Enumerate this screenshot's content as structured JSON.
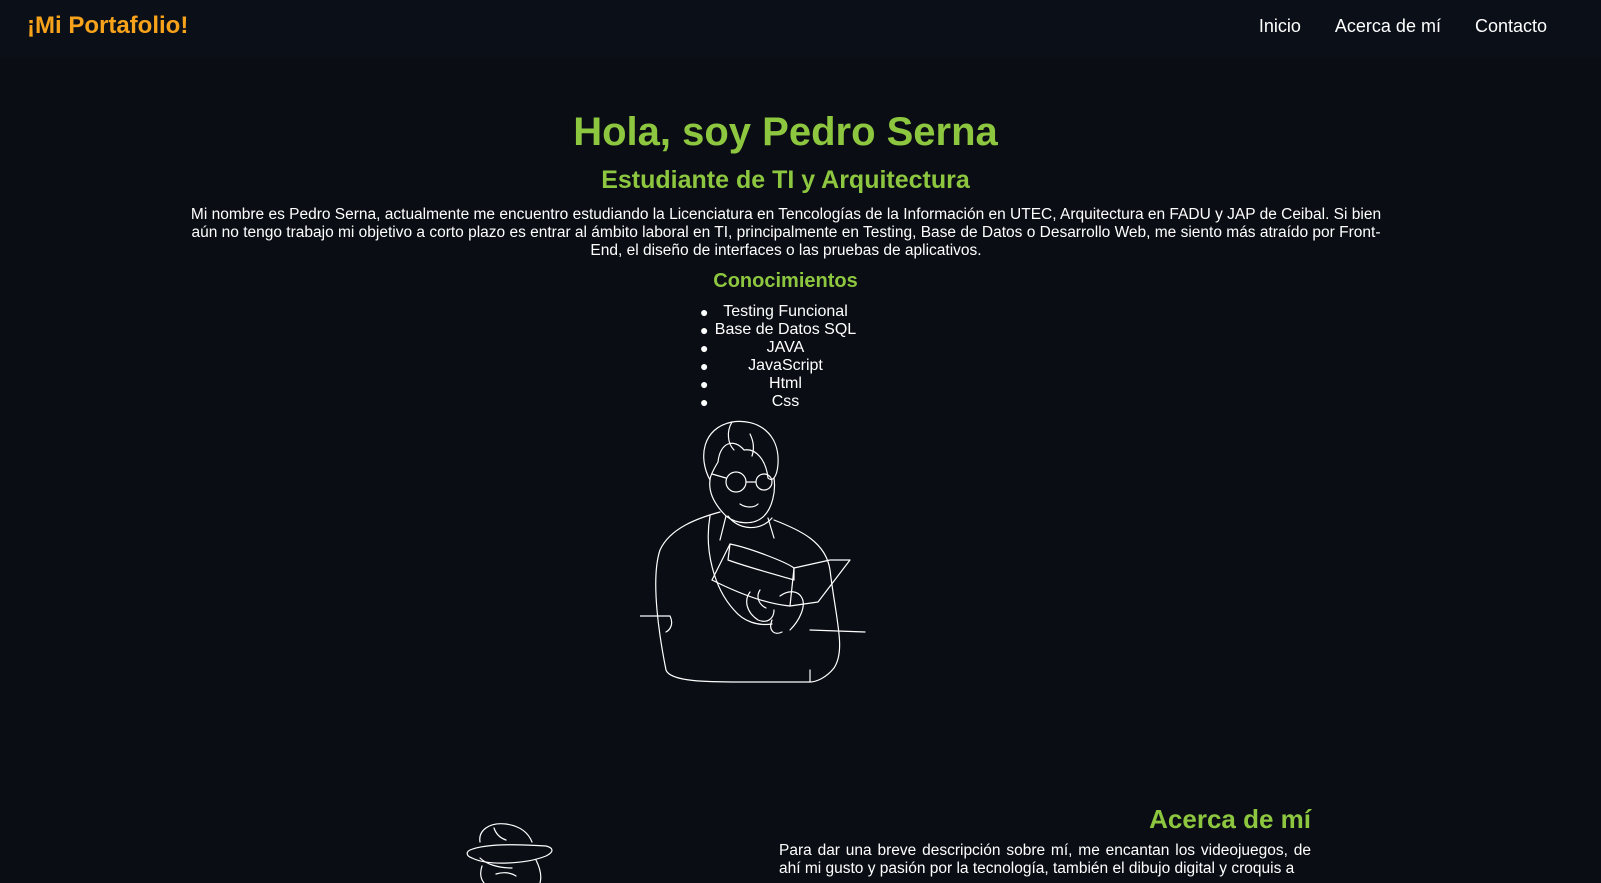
{
  "header": {
    "brand": "¡Mi Portafolio!",
    "nav": [
      "Inicio",
      "Acerca de mí",
      "Contacto"
    ]
  },
  "hero": {
    "title": "Hola, soy Pedro Serna",
    "subtitle": "Estudiante de TI y Arquitectura",
    "description": "Mi nombre es Pedro Serna, actualmente me encuentro estudiando la Licenciatura en Tencologías de la Información en UTEC, Arquitectura en FADU y JAP de Ceibal. Si bien aún no tengo trabajo mi objetivo a corto plazo es entrar al ámbito laboral en TI, principalmente en Testing, Base de Datos o Desarrollo Web, me siento más atraído por Front-End, el diseño de interfaces o las pruebas de aplicativos.",
    "skills_title": "Conocimientos",
    "skills": [
      "Testing Funcional",
      "Base de Datos SQL",
      "JAVA",
      "JavaScript",
      "Html",
      "Css"
    ]
  },
  "about": {
    "title": "Acerca de mí",
    "text": "Para dar una breve descripción sobre mí, me encantan los videojuegos, de ahí mi gusto y pasión por la tecnología, también el dibujo digital y croquis a"
  },
  "colors": {
    "background": "#0a0d14",
    "brand": "#f7a21b",
    "accent": "#8dc63f",
    "text": "#ffffff"
  },
  "icons": {
    "hero": "line-art-person-reading-illustration",
    "about": "line-art-person-with-hat-illustration"
  }
}
